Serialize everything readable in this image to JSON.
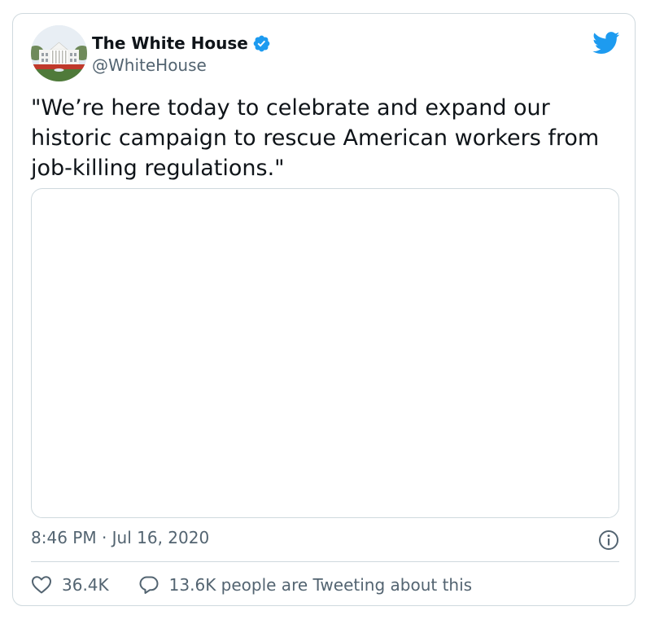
{
  "tweet": {
    "author": {
      "display_name": "The White House",
      "handle": "@WhiteHouse",
      "verified": true
    },
    "text": "\"We’re here today to celebrate and expand our historic campaign to rescue American workers from job-killing regulations.\"",
    "timestamp": "8:46 PM · Jul 16, 2020",
    "stats": {
      "likes": "36.4K",
      "replies_text": "13.6K people are Tweeting about this"
    }
  },
  "icons": {
    "brand": "twitter-bird-icon",
    "verified": "verified-badge-icon",
    "info": "info-icon",
    "like": "heart-icon",
    "reply": "speech-bubble-icon"
  },
  "colors": {
    "twitter_blue": "#1d9bf0",
    "text_primary": "#0f1419",
    "text_secondary": "#536471",
    "border": "#cfd9de"
  }
}
